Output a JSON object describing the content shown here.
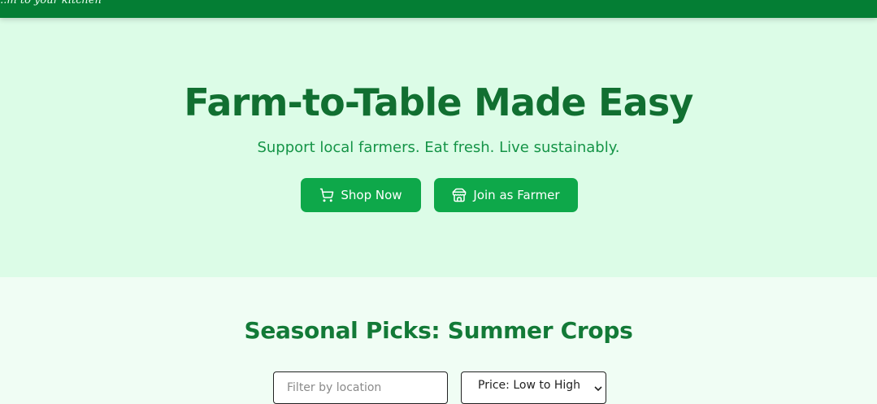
{
  "header": {
    "tagline": "...m to your kitchen"
  },
  "hero": {
    "title": "Farm-to-Table Made Easy",
    "subtitle": "Support local farmers. Eat fresh. Live sustainably.",
    "buttons": [
      {
        "label": "Shop Now",
        "icon": "shopping-cart-icon"
      },
      {
        "label": "Join as Farmer",
        "icon": "storefront-icon"
      }
    ]
  },
  "seasonal": {
    "title": "Seasonal Picks: Summer Crops",
    "filter_placeholder": "Filter by location",
    "sort_value": "Price: Low to High"
  },
  "colors": {
    "header_bg": "#047e34",
    "hero_bg": "#dcfce7",
    "page_bg": "#f0fdf4",
    "primary_button": "#0ea84a",
    "title_green": "#116f31"
  }
}
